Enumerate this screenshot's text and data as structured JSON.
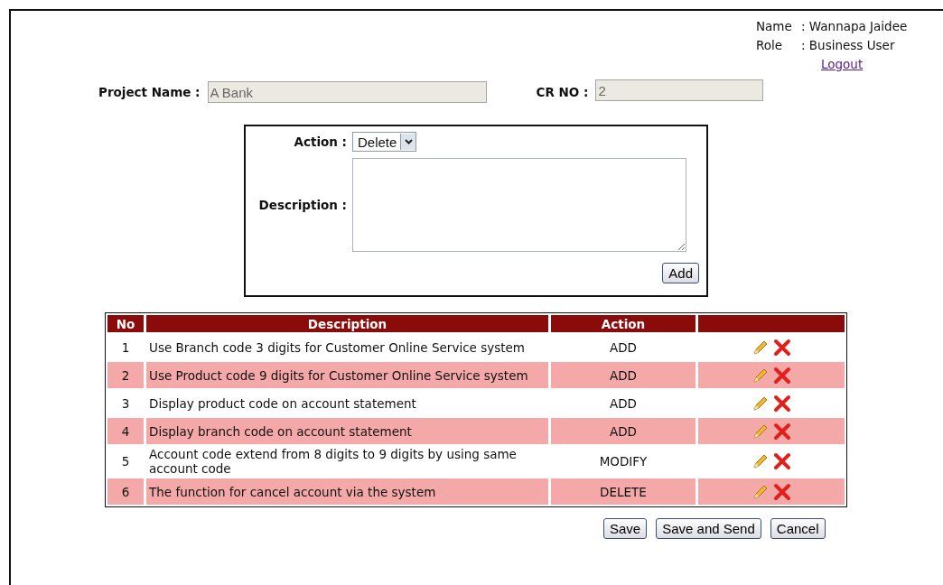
{
  "user": {
    "name_label": "Name",
    "name_value": ": Wannapa Jaidee",
    "role_label": "Role",
    "role_value": ": Business User",
    "logout": "Logout"
  },
  "project": {
    "label": "Project Name :",
    "value": "A Bank"
  },
  "cr": {
    "label": "CR NO :",
    "value": "2"
  },
  "form": {
    "action_label": "Action :",
    "action_value": "Delete",
    "description_label": "Description :",
    "add": "Add"
  },
  "table": {
    "columns": [
      "No",
      "Description",
      "Action",
      ""
    ],
    "rows": [
      {
        "no": "1",
        "description": "Use Branch code 3 digits for Customer Online Service system",
        "action": "ADD"
      },
      {
        "no": "2",
        "description": "Use Product code 9 digits for Customer Online Service system",
        "action": "ADD"
      },
      {
        "no": "3",
        "description": "Display product code on account statement",
        "action": "ADD"
      },
      {
        "no": "4",
        "description": "Display branch code on account statement",
        "action": "ADD"
      },
      {
        "no": "5",
        "description": "Account code extend from 8 digits to 9 digits by using same account code",
        "action": "MODIFY"
      },
      {
        "no": "6",
        "description": "The function for cancel account via the system",
        "action": "DELETE"
      }
    ]
  },
  "buttons": [
    "Save",
    "Save and Send",
    "Cancel"
  ]
}
